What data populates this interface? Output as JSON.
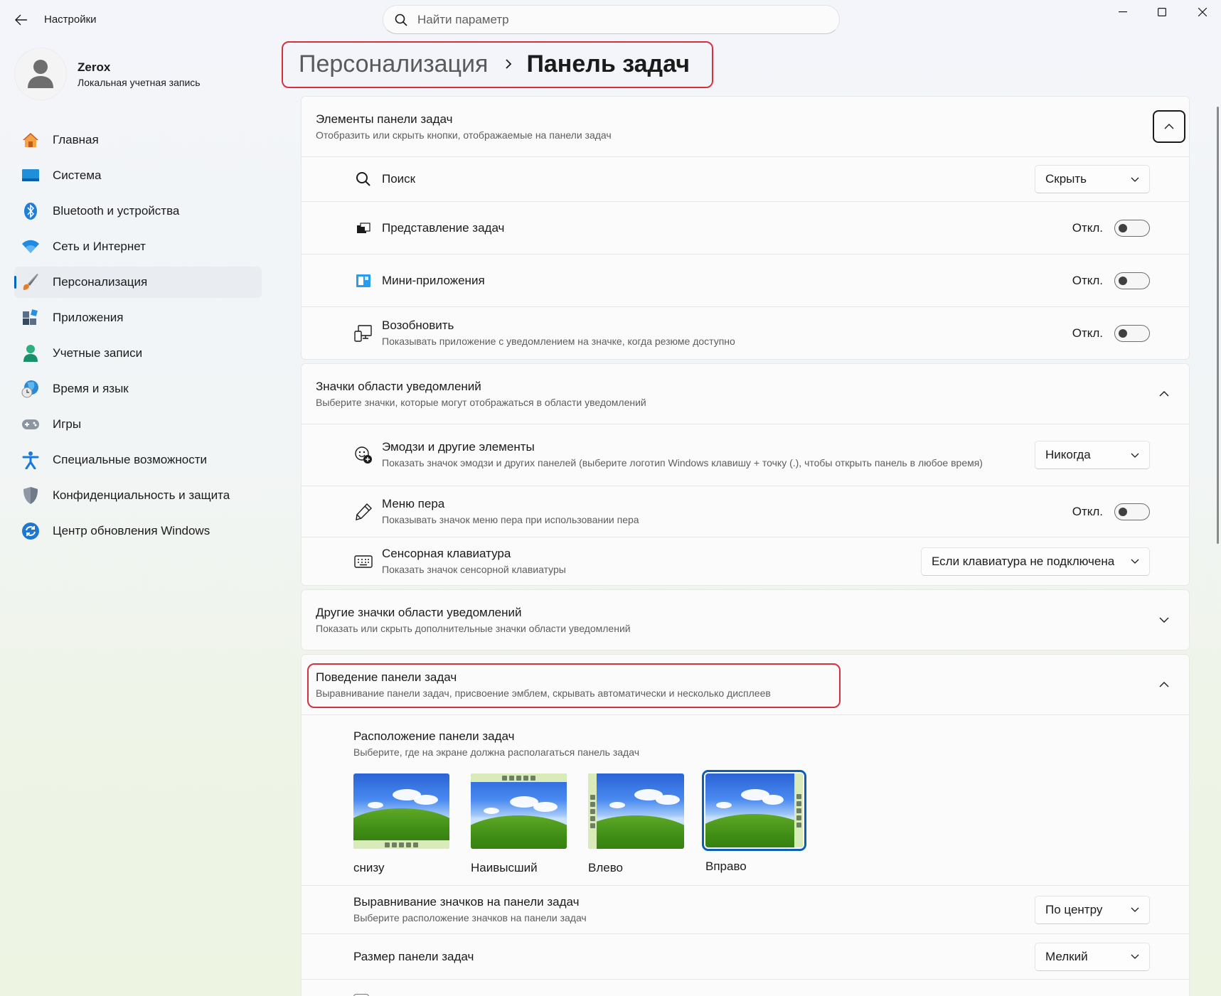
{
  "app": {
    "title": "Настройки",
    "search_placeholder": "Найти параметр"
  },
  "profile": {
    "name": "Zerox",
    "account_type": "Локальная учетная запись"
  },
  "sidebar": {
    "items": [
      {
        "label": "Главная",
        "icon": "home-icon"
      },
      {
        "label": "Система",
        "icon": "system-icon"
      },
      {
        "label": "Bluetooth и устройства",
        "icon": "bluetooth-icon"
      },
      {
        "label": "Сеть и Интернет",
        "icon": "wifi-icon"
      },
      {
        "label": "Персонализация",
        "icon": "brush-icon",
        "active": true
      },
      {
        "label": "Приложения",
        "icon": "apps-icon"
      },
      {
        "label": "Учетные записи",
        "icon": "person-icon"
      },
      {
        "label": "Время и язык",
        "icon": "globe-clock-icon"
      },
      {
        "label": "Игры",
        "icon": "gamepad-icon"
      },
      {
        "label": "Специальные возможности",
        "icon": "accessibility-icon"
      },
      {
        "label": "Конфиденциальность и защита",
        "icon": "shield-icon"
      },
      {
        "label": "Центр обновления Windows",
        "icon": "update-icon"
      }
    ]
  },
  "breadcrumb": {
    "parent": "Персонализация",
    "current": "Панель задач"
  },
  "sections": {
    "taskbar_items": {
      "title": "Элементы панели задач",
      "desc": "Отобразить или скрыть кнопки, отображаемые на панели задач",
      "rows": {
        "search": {
          "title": "Поиск",
          "value": "Скрыть"
        },
        "task_view": {
          "title": "Представление задач",
          "state": "Откл."
        },
        "widgets": {
          "title": "Мини-приложения",
          "state": "Откл."
        },
        "resume": {
          "title": "Возобновить",
          "desc": "Показывать приложение с уведомлением на значке, когда резюме доступно",
          "state": "Откл."
        }
      }
    },
    "tray_icons": {
      "title": "Значки области уведомлений",
      "desc": "Выберите значки, которые могут отображаться в области уведомлений",
      "rows": {
        "emoji": {
          "title": "Эмодзи и другие элементы",
          "desc": "Показать значок эмодзи и других панелей (выберите логотип Windows клавишу + точку (.), чтобы открыть панель в любое время)",
          "value": "Никогда"
        },
        "pen": {
          "title": "Меню пера",
          "desc": "Показывать значок меню пера при использовании пера",
          "state": "Откл."
        },
        "keyboard": {
          "title": "Сенсорная клавиатура",
          "desc": "Показать значок сенсорной клавиатуры",
          "value": "Если клавиатура не подключена"
        }
      }
    },
    "other_tray": {
      "title": "Другие значки области уведомлений",
      "desc": "Показать или скрыть дополнительные значки области уведомлений"
    },
    "behavior": {
      "title": "Поведение панели задач",
      "desc": "Выравнивание панели задач, присвоение эмблем, скрывать автоматически и несколько дисплеев",
      "location": {
        "title": "Расположение панели задач",
        "desc": "Выберите, где на экране должна располагаться панель задач",
        "options": [
          "снизу",
          "Наивысший",
          "Влево",
          "Вправо"
        ],
        "selected": "Вправо"
      },
      "alignment": {
        "title": "Выравнивание значков на панели задач",
        "desc": "Выберите расположение значков на панели задач",
        "value": "По центру"
      },
      "size": {
        "title": "Размер панели задач",
        "value": "Мелкий"
      }
    }
  },
  "colors": {
    "accent": "#0067c0",
    "highlight": "#d7313e"
  }
}
